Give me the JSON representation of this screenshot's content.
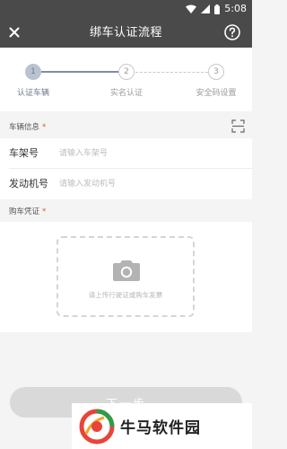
{
  "status_bar": {
    "time": "5:08",
    "icons": [
      "wifi-icon",
      "signal-icon",
      "battery-icon"
    ]
  },
  "header": {
    "title": "绑车认证流程",
    "close_icon": "close-icon",
    "help_icon": "help-icon"
  },
  "steps": [
    {
      "number": "1",
      "label": "认证车辆",
      "active": true
    },
    {
      "number": "2",
      "label": "实名认证",
      "active": false
    },
    {
      "number": "3",
      "label": "安全码设置",
      "active": false
    }
  ],
  "vehicle_section": {
    "title": "车辆信息",
    "required_mark": "*",
    "scan_icon": "scan-icon"
  },
  "fields": [
    {
      "label": "车架号",
      "value": "",
      "placeholder": "请输入车架号"
    },
    {
      "label": "发动机号",
      "value": "",
      "placeholder": "请输入发动机号"
    }
  ],
  "purchase_section": {
    "title": "购车凭证",
    "required_mark": "*"
  },
  "upload": {
    "icon": "camera-icon",
    "hint": "请上传行驶证或购车发票"
  },
  "next_button": {
    "label": "下一步"
  },
  "watermark": {
    "text": "牛马软件园"
  },
  "colors": {
    "header_bg": "#4a4a4a",
    "accent": "#7e8ea0",
    "required": "#e0543f",
    "button_disabled": "#d9d9d9"
  }
}
